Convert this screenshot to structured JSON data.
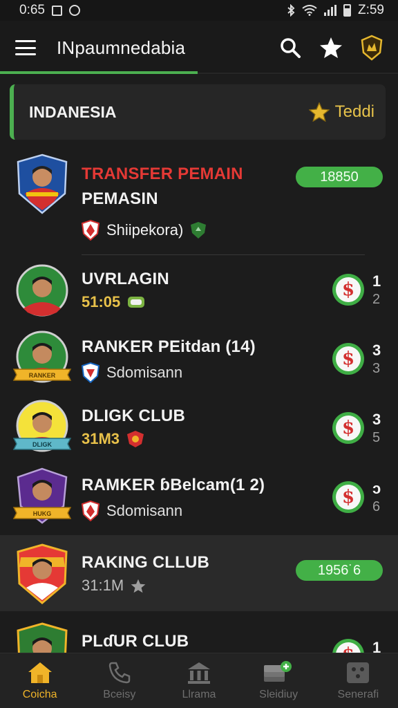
{
  "status_bar": {
    "time_left": "0:65",
    "time_right": "Z:59"
  },
  "app_bar": {
    "title": "INpaumnedabia"
  },
  "country": {
    "name": "INDANESIA",
    "favorite_label": "Teddi"
  },
  "featured": {
    "title_line1": "TRANSFER PEMAIN",
    "title_line2": "PEMASIN",
    "subtitle": "Shiipekora)",
    "pill": "18850"
  },
  "list": [
    {
      "title": "UVRLAGIN",
      "sub": "51:05",
      "rank_top": "1",
      "rank_bottom": "2"
    },
    {
      "title": "RANKER PEitdan (14)",
      "sub": "Sdomisann",
      "rank_top": "3",
      "rank_bottom": "3",
      "badge": "RANKER"
    },
    {
      "title": "DLIGK CLUB",
      "sub": "31M3",
      "rank_top": "3",
      "rank_bottom": "5",
      "badge": "DLIGK"
    },
    {
      "title": "RAMKER ɓBelcam(1 2)",
      "sub": "Sdomisann",
      "rank_top": "ɔ",
      "rank_bottom": "6",
      "badge": "HUKG"
    }
  ],
  "raking": {
    "title": "RAKING CLLUB",
    "sub": "31:1M",
    "pill": "1956˙6"
  },
  "partial": {
    "title": "PLɗUR CLUB",
    "rank_top": "1"
  },
  "bottom_nav": [
    {
      "label": "Coicha"
    },
    {
      "label": "Bceisy"
    },
    {
      "label": "Llrama"
    },
    {
      "label": "Sleidiuy"
    },
    {
      "label": "Senerafi"
    }
  ]
}
